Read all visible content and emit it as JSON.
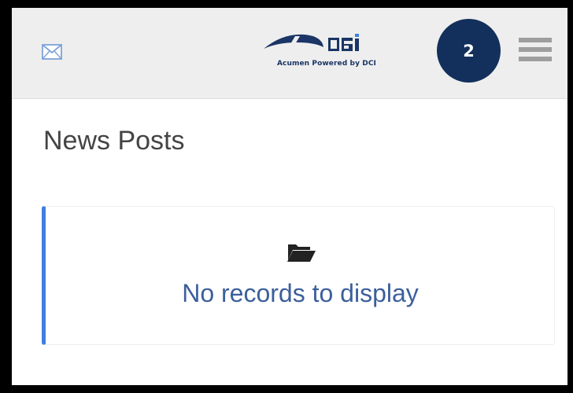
{
  "header": {
    "logo_caption": "Acumen Powered by DCI",
    "notification_count": "2",
    "icons": [
      "mail-icon",
      "logo-icon",
      "hamburger-menu-icon"
    ]
  },
  "main": {
    "title": "News Posts",
    "empty_state": {
      "icon": "folder-open-icon",
      "message": "No records to display"
    }
  },
  "colors": {
    "header_bg": "#eeeeee",
    "badge_bg": "#13305c",
    "accent_border": "#3f7fe0",
    "empty_text": "#3c5f9c",
    "logo_blue": "#1a3566"
  }
}
